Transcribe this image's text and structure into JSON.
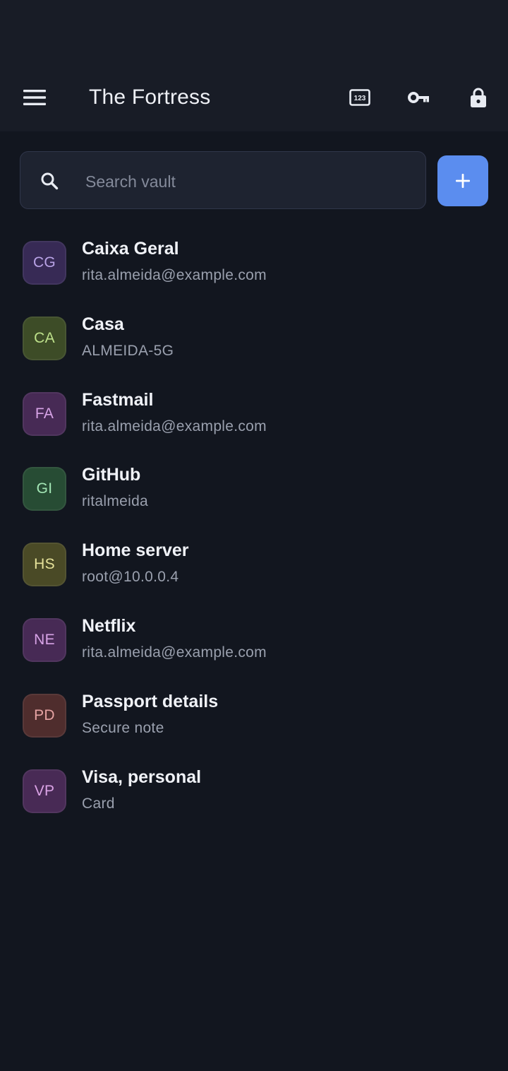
{
  "appbar": {
    "title": "The Fortress",
    "menu_icon": "menu-icon",
    "actions": [
      "number-pad-icon",
      "key-icon",
      "lock-icon"
    ]
  },
  "search": {
    "placeholder": "Search vault",
    "value": ""
  },
  "add_icon": "plus-icon",
  "colors": {
    "background": "#12161f",
    "appbar": "#181c26",
    "accent": "#5b8def"
  },
  "items": [
    {
      "initials": "CG",
      "title": "Caixa Geral",
      "subtitle": "rita.almeida@example.com",
      "bg": "#372a55",
      "fg": "#b9a3e6"
    },
    {
      "initials": "CA",
      "title": "Casa",
      "subtitle": "ALMEIDA-5G",
      "bg": "#3d4c27",
      "fg": "#bde08a"
    },
    {
      "initials": "FA",
      "title": "Fastmail",
      "subtitle": "rita.almeida@example.com",
      "bg": "#472a55",
      "fg": "#d7a3e6"
    },
    {
      "initials": "GI",
      "title": "GitHub",
      "subtitle": "ritalmeida",
      "bg": "#274c34",
      "fg": "#a3e6b5"
    },
    {
      "initials": "HS",
      "title": "Home server",
      "subtitle": "root@10.0.0.4",
      "bg": "#4a4a26",
      "fg": "#e6e29a"
    },
    {
      "initials": "NE",
      "title": "Netflix",
      "subtitle": "rita.almeida@example.com",
      "bg": "#472a55",
      "fg": "#d7a3e6"
    },
    {
      "initials": "PD",
      "title": "Passport details",
      "subtitle": "Secure note",
      "bg": "#4f2d2d",
      "fg": "#e6a3a3"
    },
    {
      "initials": "VP",
      "title": "Visa, personal",
      "subtitle": "Card",
      "bg": "#482a55",
      "fg": "#dba3e6"
    }
  ]
}
